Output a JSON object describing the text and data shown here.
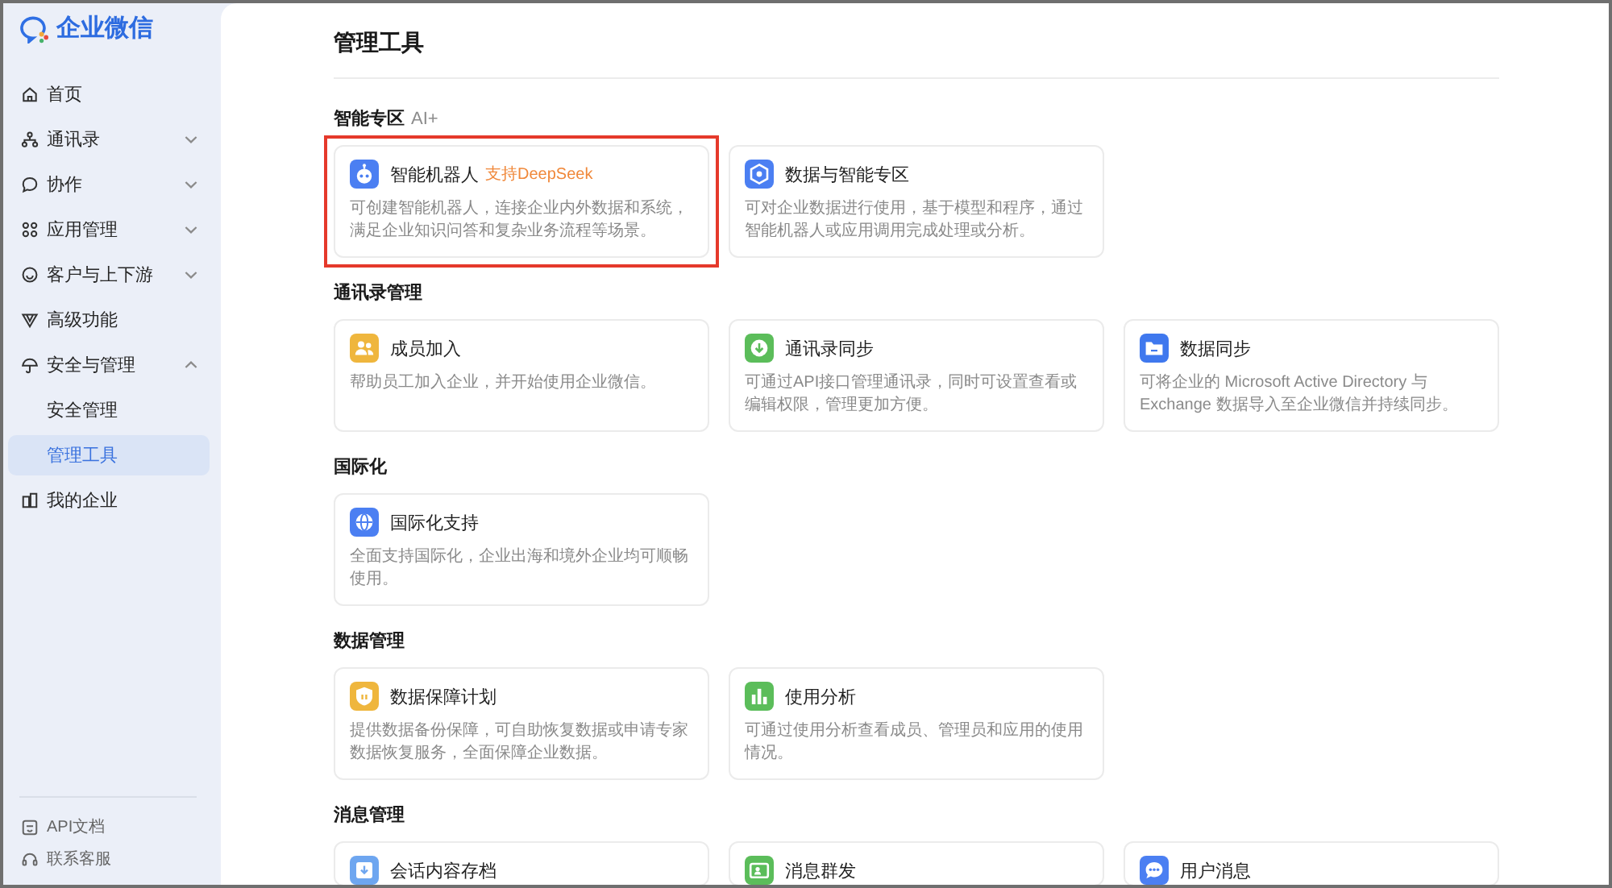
{
  "sidebar": {
    "logo": "企业微信",
    "items": [
      {
        "label": "首页",
        "kind": "link",
        "selected": false
      },
      {
        "label": "通讯录",
        "kind": "group",
        "expanded": false,
        "selected": false
      },
      {
        "label": "协作",
        "kind": "group",
        "expanded": false,
        "selected": false
      },
      {
        "label": "应用管理",
        "kind": "group",
        "expanded": false,
        "selected": false
      },
      {
        "label": "客户与上下游",
        "kind": "group",
        "expanded": false,
        "selected": false
      },
      {
        "label": "高级功能",
        "kind": "link",
        "selected": false
      },
      {
        "label": "安全与管理",
        "kind": "group",
        "expanded": true,
        "selected": false,
        "children": [
          {
            "label": "安全管理",
            "selected": false
          },
          {
            "label": "管理工具",
            "selected": true
          }
        ]
      },
      {
        "label": "我的企业",
        "kind": "link",
        "selected": false
      }
    ],
    "footer_links": [
      "API文档",
      "联系客服"
    ]
  },
  "page": {
    "title": "管理工具"
  },
  "sections": [
    {
      "title": "智能专区",
      "tag": "AI+",
      "cards": [
        {
          "title": "智能机器人",
          "badge": "支持DeepSeek",
          "description": "可创建智能机器人，连接企业内外数据和系统，满足企业知识问答和复杂业务流程等场景。",
          "color": "#4b7ff2",
          "highlighted": true
        },
        {
          "title": "数据与智能专区",
          "description": "可对企业数据进行使用，基于模型和程序，通过智能机器人或应用调用完成处理或分析。",
          "color": "#4b7ff2",
          "highlighted": false
        }
      ]
    },
    {
      "title": "通讯录管理",
      "cards": [
        {
          "title": "成员加入",
          "description": "帮助员工加入企业，并开始使用企业微信。",
          "color": "#efb63d",
          "highlighted": false
        },
        {
          "title": "通讯录同步",
          "description": "可通过API接口管理通讯录，同时可设置查看或编辑权限，管理更加方便。",
          "color": "#5bbd5a",
          "highlighted": false
        },
        {
          "title": "数据同步",
          "description": "可将企业的 Microsoft Active Directory 与 Exchange 数据导入至企业微信并持续同步。",
          "color": "#3f78ee",
          "highlighted": false
        }
      ]
    },
    {
      "title": "国际化",
      "cards": [
        {
          "title": "国际化支持",
          "description": "全面支持国际化，企业出海和境外企业均可顺畅使用。",
          "color": "#4b7ff2",
          "highlighted": false
        }
      ]
    },
    {
      "title": "数据管理",
      "cards": [
        {
          "title": "数据保障计划",
          "description": "提供数据备份保障，可自助恢复数据或申请专家数据恢复服务，全面保障企业数据。",
          "color": "#efb63d",
          "highlighted": false
        },
        {
          "title": "使用分析",
          "description": "可通过使用分析查看成员、管理员和应用的使用情况。",
          "color": "#5bbd5a",
          "highlighted": false
        }
      ]
    },
    {
      "title": "消息管理",
      "cards": [
        {
          "title": "会话内容存档",
          "color": "#6ea6f0",
          "highlighted": false
        },
        {
          "title": "消息群发",
          "color": "#5bbd5a",
          "highlighted": false
        },
        {
          "title": "用户消息",
          "color": "#4b7ff2",
          "highlighted": false
        }
      ]
    }
  ]
}
